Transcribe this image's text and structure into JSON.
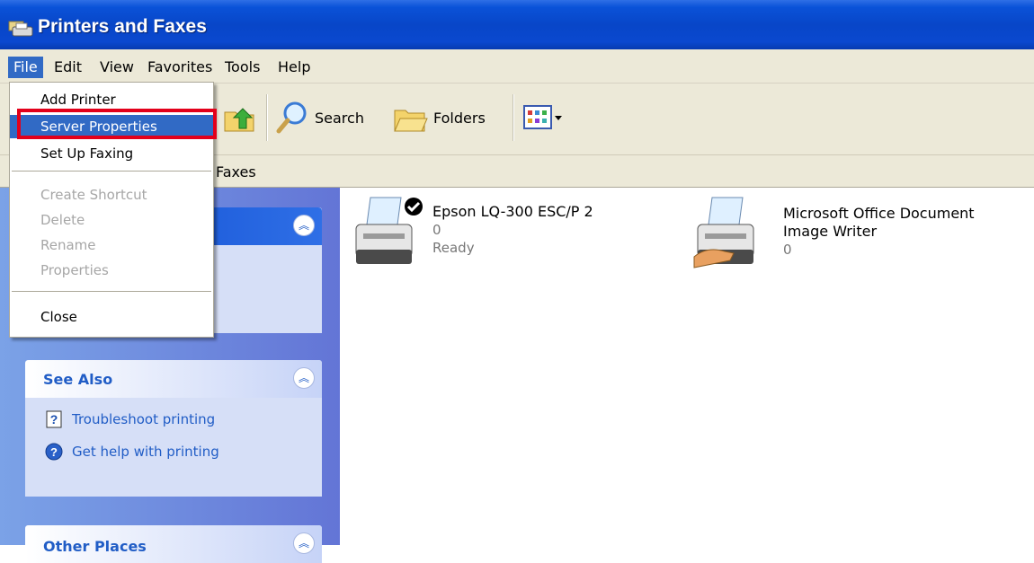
{
  "window": {
    "title": "Printers and Faxes"
  },
  "menubar": {
    "items": [
      "File",
      "Edit",
      "View",
      "Favorites",
      "Tools",
      "Help"
    ],
    "active": "File"
  },
  "toolbar": {
    "search_label": "Search",
    "folders_label": "Folders"
  },
  "address": {
    "partial_text": "Faxes"
  },
  "file_menu": {
    "items": [
      {
        "label": "Add Printer",
        "enabled": true
      },
      {
        "label": "Server Properties",
        "enabled": true,
        "highlighted": true
      },
      {
        "label": "Set Up Faxing",
        "enabled": true
      },
      {
        "label": "Create Shortcut",
        "enabled": false
      },
      {
        "label": "Delete",
        "enabled": false
      },
      {
        "label": "Rename",
        "enabled": false
      },
      {
        "label": "Properties",
        "enabled": false
      },
      {
        "label": "Close",
        "enabled": true
      }
    ]
  },
  "left_pane": {
    "see_also": {
      "title": "See Also",
      "tasks": [
        "Troubleshoot printing",
        "Get help with printing"
      ]
    },
    "other_places": {
      "title": "Other Places"
    }
  },
  "printers": [
    {
      "name": "Epson LQ-300 ESC/P 2",
      "documents": "0",
      "status": "Ready",
      "default": true
    },
    {
      "name_line1": "Microsoft Office Document",
      "name_line2": "Image Writer",
      "documents": "0"
    }
  ],
  "colors": {
    "titlebar": "#0846c8",
    "highlight": "#316ac5",
    "annotation": "#e3001b",
    "task_link": "#215dc6"
  }
}
